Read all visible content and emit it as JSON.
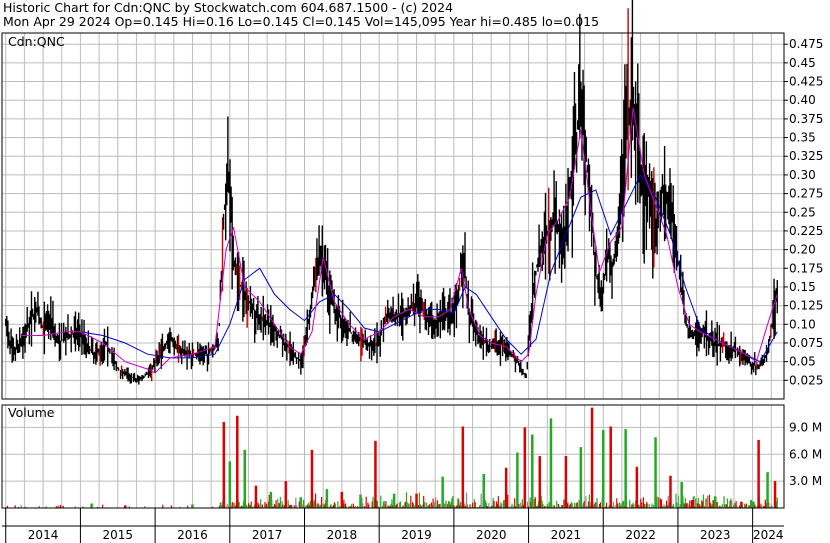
{
  "header": {
    "line1": "Historic Chart for Cdn:QNC by Stockwatch.com 604.687.1500 - (c) 2024",
    "line2": "Mon Apr 29 2024   Op=0.145  Hi=0.16  Lo=0.145  Cl=0.145  Vol=145,095  Year hi=0.485  lo=0.015"
  },
  "colors": {
    "background": "#ffffff",
    "grid": "#bcbcbc",
    "price_bars": "#000000",
    "moving_avg_short": "#cc00cc",
    "moving_avg_long": "#0000cc",
    "volume_up": "#22aa22",
    "volume_down": "#dd0000",
    "volume_flat": "#888888",
    "divider": "#000000"
  },
  "chart_data": [
    {
      "type": "line",
      "title": "Cdn:QNC",
      "subtype": "ohlc_bars_with_moving_averages",
      "ylim": [
        0.0,
        0.49
      ],
      "y_ticks": [
        "0.475",
        "0.45",
        "0.425",
        "0.40",
        "0.375",
        "0.35",
        "0.325",
        "0.30",
        "0.275",
        "0.25",
        "0.225",
        "0.20",
        "0.175",
        "0.15",
        "0.125",
        "0.10",
        "0.075",
        "0.05",
        "0.025"
      ],
      "x_labels": [
        "2014",
        "2015",
        "2016",
        "2017",
        "2018",
        "2019",
        "2020",
        "2021",
        "2022",
        "2023",
        "2024"
      ],
      "x_domain": [
        2013.95,
        2024.42
      ],
      "grid": true,
      "close_series": {
        "x": [
          2014.0,
          2014.1,
          2014.25,
          2014.4,
          2014.5,
          2014.6,
          2014.7,
          2014.85,
          2015.0,
          2015.1,
          2015.2,
          2015.35,
          2015.5,
          2015.6,
          2015.75,
          2015.85,
          2015.95,
          2016.05,
          2016.2,
          2016.35,
          2016.5,
          2016.7,
          2016.85,
          2016.92,
          2016.98,
          2017.05,
          2017.15,
          2017.25,
          2017.4,
          2017.55,
          2017.7,
          2017.85,
          2017.95,
          2018.05,
          2018.2,
          2018.35,
          2018.5,
          2018.65,
          2018.8,
          2018.95,
          2019.1,
          2019.25,
          2019.4,
          2019.5,
          2019.6,
          2019.75,
          2019.85,
          2019.95,
          2020.05,
          2020.12,
          2020.2,
          2020.35,
          2020.5,
          2020.6,
          2020.7,
          2020.82,
          2020.9,
          2020.97,
          2021.05,
          2021.15,
          2021.25,
          2021.35,
          2021.45,
          2021.55,
          2021.62,
          2021.7,
          2021.8,
          2021.9,
          2021.98,
          2022.05,
          2022.12,
          2022.2,
          2022.3,
          2022.4,
          2022.5,
          2022.6,
          2022.7,
          2022.8,
          2022.9,
          2023.0,
          2023.1,
          2023.2,
          2023.35,
          2023.5,
          2023.65,
          2023.75,
          2023.85,
          2023.95,
          2024.0,
          2024.1,
          2024.2,
          2024.3,
          2024.33
        ],
        "y": [
          0.1,
          0.06,
          0.085,
          0.12,
          0.095,
          0.11,
          0.075,
          0.085,
          0.09,
          0.07,
          0.06,
          0.075,
          0.04,
          0.035,
          0.025,
          0.03,
          0.04,
          0.06,
          0.08,
          0.065,
          0.06,
          0.06,
          0.075,
          0.25,
          0.3,
          0.18,
          0.15,
          0.13,
          0.11,
          0.1,
          0.08,
          0.06,
          0.05,
          0.1,
          0.2,
          0.13,
          0.105,
          0.085,
          0.075,
          0.07,
          0.11,
          0.11,
          0.12,
          0.125,
          0.115,
          0.1,
          0.11,
          0.11,
          0.14,
          0.195,
          0.11,
          0.08,
          0.07,
          0.075,
          0.07,
          0.055,
          0.04,
          0.03,
          0.14,
          0.2,
          0.22,
          0.25,
          0.2,
          0.28,
          0.33,
          0.4,
          0.3,
          0.17,
          0.13,
          0.2,
          0.17,
          0.22,
          0.36,
          0.4,
          0.3,
          0.28,
          0.22,
          0.28,
          0.25,
          0.19,
          0.1,
          0.085,
          0.09,
          0.075,
          0.07,
          0.07,
          0.06,
          0.05,
          0.045,
          0.045,
          0.06,
          0.13,
          0.145
        ]
      },
      "moving_average_long": {
        "x": [
          2015.0,
          2015.3,
          2015.6,
          2015.9,
          2016.2,
          2016.5,
          2016.8,
          2017.0,
          2017.2,
          2017.4,
          2017.6,
          2017.8,
          2018.0,
          2018.2,
          2018.4,
          2018.6,
          2018.8,
          2019.0,
          2019.2,
          2019.4,
          2019.6,
          2019.8,
          2020.0,
          2020.15,
          2020.3,
          2020.5,
          2020.7,
          2020.9,
          2021.1,
          2021.3,
          2021.5,
          2021.7,
          2021.9,
          2022.1,
          2022.3,
          2022.5,
          2022.7,
          2022.9,
          2023.1,
          2023.3,
          2023.5,
          2023.7,
          2023.9,
          2024.1,
          2024.33
        ],
        "y": [
          0.09,
          0.085,
          0.075,
          0.06,
          0.055,
          0.055,
          0.06,
          0.1,
          0.16,
          0.175,
          0.14,
          0.12,
          0.105,
          0.13,
          0.14,
          0.12,
          0.095,
          0.09,
          0.1,
          0.11,
          0.12,
          0.12,
          0.115,
          0.15,
          0.14,
          0.11,
          0.08,
          0.06,
          0.08,
          0.17,
          0.22,
          0.27,
          0.28,
          0.22,
          0.26,
          0.3,
          0.27,
          0.22,
          0.15,
          0.095,
          0.08,
          0.07,
          0.06,
          0.05,
          0.09
        ]
      },
      "moving_average_short": {
        "x": [
          2014.2,
          2014.5,
          2014.8,
          2015.0,
          2015.3,
          2015.6,
          2015.9,
          2016.0,
          2016.2,
          2016.5,
          2016.8,
          2016.95,
          2017.05,
          2017.2,
          2017.4,
          2017.6,
          2017.8,
          2017.95,
          2018.1,
          2018.25,
          2018.4,
          2018.6,
          2018.8,
          2019.0,
          2019.2,
          2019.4,
          2019.6,
          2019.8,
          2019.95,
          2020.1,
          2020.2,
          2020.35,
          2020.5,
          2020.7,
          2020.9,
          2021.0,
          2021.1,
          2021.25,
          2021.4,
          2021.55,
          2021.7,
          2021.85,
          2021.95,
          2022.1,
          2022.25,
          2022.4,
          2022.55,
          2022.7,
          2022.85,
          2023.0,
          2023.15,
          2023.3,
          2023.5,
          2023.7,
          2023.9,
          2024.05,
          2024.2,
          2024.33
        ],
        "y": [
          0.085,
          0.085,
          0.09,
          0.09,
          0.075,
          0.05,
          0.04,
          0.035,
          0.055,
          0.06,
          0.07,
          0.2,
          0.23,
          0.15,
          0.13,
          0.1,
          0.07,
          0.06,
          0.09,
          0.19,
          0.13,
          0.1,
          0.08,
          0.09,
          0.11,
          0.12,
          0.11,
          0.11,
          0.12,
          0.175,
          0.12,
          0.085,
          0.075,
          0.07,
          0.05,
          0.06,
          0.14,
          0.22,
          0.24,
          0.27,
          0.36,
          0.24,
          0.17,
          0.21,
          0.23,
          0.39,
          0.3,
          0.26,
          0.22,
          0.15,
          0.1,
          0.09,
          0.08,
          0.07,
          0.06,
          0.05,
          0.1,
          0.14
        ]
      }
    },
    {
      "type": "bar",
      "title": "Volume",
      "y_ticks": [
        "9.0 M",
        "6.0 M",
        "3.0 M"
      ],
      "ylim": [
        0,
        11500000
      ],
      "peaks": {
        "x": [
          2015.15,
          2015.6,
          2016.5,
          2016.92,
          2017.0,
          2017.1,
          2017.2,
          2017.35,
          2017.55,
          2017.75,
          2017.95,
          2018.1,
          2018.3,
          2018.5,
          2018.75,
          2018.95,
          2019.2,
          2019.5,
          2019.85,
          2020.12,
          2020.4,
          2020.7,
          2020.85,
          2020.95,
          2021.05,
          2021.15,
          2021.3,
          2021.5,
          2021.7,
          2021.85,
          2022.0,
          2022.1,
          2022.3,
          2022.45,
          2022.7,
          2022.9,
          2023.05,
          2023.2,
          2023.5,
          2023.85,
          2024.0,
          2024.08,
          2024.2,
          2024.3
        ],
        "v": [
          500000,
          300000,
          400000,
          9600000,
          5200000,
          10300000,
          6500000,
          2500000,
          1800000,
          3000000,
          1200000,
          6500000,
          2100000,
          1800000,
          1500000,
          7500000,
          1600000,
          1600000,
          3500000,
          9100000,
          3800000,
          4500000,
          6200000,
          9000000,
          8200000,
          5800000,
          10000000,
          5800000,
          6800000,
          11200000,
          8700000,
          9100000,
          8800000,
          4600000,
          7900000,
          3600000,
          2900000,
          900000,
          1300000,
          700000,
          700000,
          7600000,
          4000000,
          3000000
        ]
      }
    }
  ]
}
